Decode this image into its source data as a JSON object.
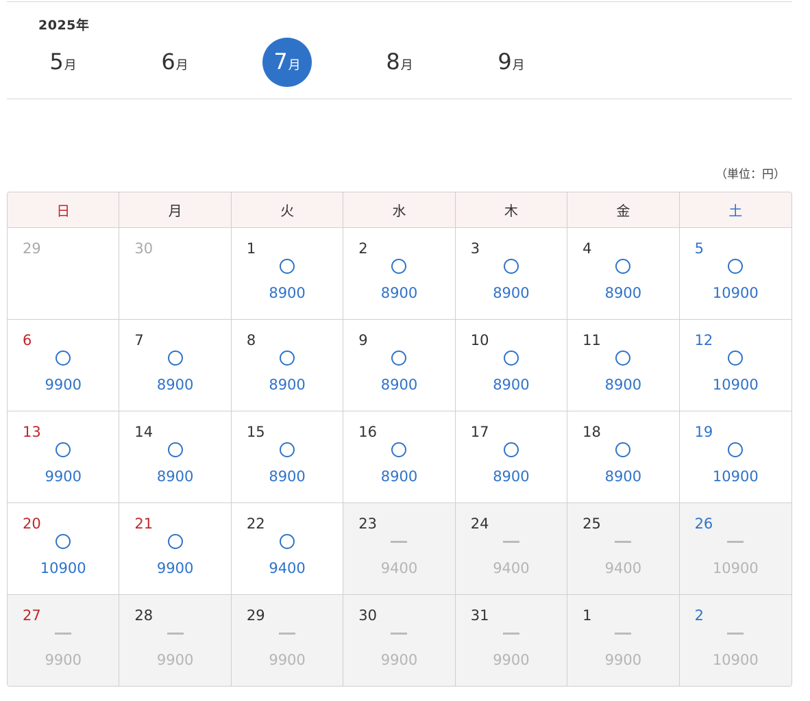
{
  "year_label": "2025年",
  "unit_note": "（単位：円）",
  "colors": {
    "accent": "#2f73c9",
    "sunday": "#c0272d",
    "saturday": "#2f73c9",
    "header_bg": "#fbf2f2",
    "closed_bg": "#f3f3f3"
  },
  "month_tabs": [
    {
      "num": "5",
      "unit": "月",
      "active": false
    },
    {
      "num": "6",
      "unit": "月",
      "active": false
    },
    {
      "num": "7",
      "unit": "月",
      "active": true
    },
    {
      "num": "8",
      "unit": "月",
      "active": false
    },
    {
      "num": "9",
      "unit": "月",
      "active": false
    }
  ],
  "weekdays": [
    "日",
    "月",
    "火",
    "水",
    "木",
    "金",
    "土"
  ],
  "weeks": [
    [
      {
        "date": "29",
        "status": "none",
        "price": "",
        "other_month": true
      },
      {
        "date": "30",
        "status": "none",
        "price": "",
        "other_month": true
      },
      {
        "date": "1",
        "status": "available",
        "price": "8900"
      },
      {
        "date": "2",
        "status": "available",
        "price": "8900"
      },
      {
        "date": "3",
        "status": "available",
        "price": "8900"
      },
      {
        "date": "4",
        "status": "available",
        "price": "8900"
      },
      {
        "date": "5",
        "status": "available",
        "price": "10900"
      }
    ],
    [
      {
        "date": "6",
        "status": "available",
        "price": "9900"
      },
      {
        "date": "7",
        "status": "available",
        "price": "8900"
      },
      {
        "date": "8",
        "status": "available",
        "price": "8900"
      },
      {
        "date": "9",
        "status": "available",
        "price": "8900"
      },
      {
        "date": "10",
        "status": "available",
        "price": "8900"
      },
      {
        "date": "11",
        "status": "available",
        "price": "8900"
      },
      {
        "date": "12",
        "status": "available",
        "price": "10900"
      }
    ],
    [
      {
        "date": "13",
        "status": "available",
        "price": "9900"
      },
      {
        "date": "14",
        "status": "available",
        "price": "8900"
      },
      {
        "date": "15",
        "status": "available",
        "price": "8900"
      },
      {
        "date": "16",
        "status": "available",
        "price": "8900"
      },
      {
        "date": "17",
        "status": "available",
        "price": "8900"
      },
      {
        "date": "18",
        "status": "available",
        "price": "8900"
      },
      {
        "date": "19",
        "status": "available",
        "price": "10900"
      }
    ],
    [
      {
        "date": "20",
        "status": "available",
        "price": "10900",
        "holiday": true
      },
      {
        "date": "21",
        "status": "available",
        "price": "9900",
        "holiday": true
      },
      {
        "date": "22",
        "status": "available",
        "price": "9400"
      },
      {
        "date": "23",
        "status": "closed",
        "price": "9400"
      },
      {
        "date": "24",
        "status": "closed",
        "price": "9400"
      },
      {
        "date": "25",
        "status": "closed",
        "price": "9400"
      },
      {
        "date": "26",
        "status": "closed",
        "price": "10900"
      }
    ],
    [
      {
        "date": "27",
        "status": "closed",
        "price": "9900"
      },
      {
        "date": "28",
        "status": "closed",
        "price": "9900"
      },
      {
        "date": "29",
        "status": "closed",
        "price": "9900"
      },
      {
        "date": "30",
        "status": "closed",
        "price": "9900"
      },
      {
        "date": "31",
        "status": "closed",
        "price": "9900"
      },
      {
        "date": "1",
        "status": "closed",
        "price": "9900"
      },
      {
        "date": "2",
        "status": "closed",
        "price": "10900"
      }
    ]
  ]
}
